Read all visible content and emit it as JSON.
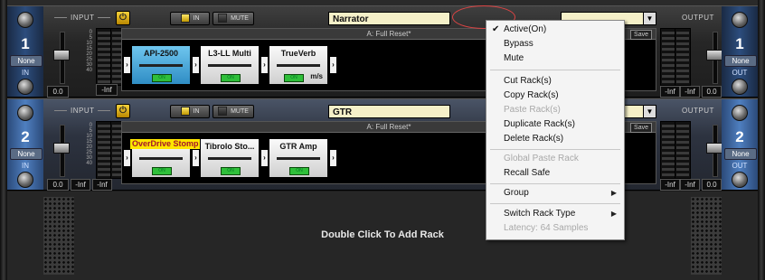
{
  "labels": {
    "input": "INPUT",
    "output": "OUTPUT",
    "in": "IN",
    "mute": "MUTE",
    "none": "None",
    "in_side": "IN",
    "out_side": "OUT",
    "save": "Save",
    "on": "ON"
  },
  "scale": [
    "0",
    "5",
    "10",
    "15",
    "20",
    "25",
    "30",
    "40"
  ],
  "rack1": {
    "number": "1",
    "name": "Narrator",
    "preset": "A: Full Reset*",
    "in_readouts": [
      "0.0",
      "-Inf"
    ],
    "out_readouts": [
      "-Inf",
      "-Inf",
      "0.0"
    ],
    "plugins": [
      {
        "name": "API-2500",
        "selected": true,
        "unit": ""
      },
      {
        "name": "L3-LL Multi",
        "selected": false,
        "unit": ""
      },
      {
        "name": "TrueVerb",
        "selected": false,
        "unit": "m/s"
      }
    ]
  },
  "rack2": {
    "number": "2",
    "name": "GTR",
    "preset": "A: Full Reset*",
    "in_readouts": [
      "0.0",
      "-Inf",
      "-Inf"
    ],
    "out_readouts": [
      "-Inf",
      "-Inf",
      "0.0"
    ],
    "plugins": [
      {
        "name": "OverDrive Stomp",
        "highlighted": true
      },
      {
        "name": "Tibrolo Sto..."
      },
      {
        "name": "GTR Amp"
      }
    ]
  },
  "empty_area": {
    "text": "Double Click To Add Rack"
  },
  "context_menu": {
    "items": [
      {
        "label": "Active(On)",
        "checked": true,
        "enabled": true
      },
      {
        "label": "Bypass",
        "enabled": true
      },
      {
        "label": "Mute",
        "enabled": true
      },
      {
        "label": "Cut Rack(s)",
        "enabled": true
      },
      {
        "label": "Copy Rack(s)",
        "enabled": true
      },
      {
        "label": "Paste Rack(s)",
        "enabled": false
      },
      {
        "label": "Duplicate Rack(s)",
        "enabled": true
      },
      {
        "label": "Delete Rack(s)",
        "enabled": true
      },
      {
        "label": "Global Paste Rack",
        "enabled": false
      },
      {
        "label": "Recall Safe",
        "enabled": true
      },
      {
        "label": "Group",
        "enabled": true,
        "submenu": true
      },
      {
        "label": "Switch Rack Type",
        "enabled": true,
        "submenu": true
      },
      {
        "label": "Latency: 64 Samples",
        "enabled": false
      }
    ]
  },
  "colors": {
    "accent": "#f7d33b",
    "selected_plugin": "#2f8dc4",
    "highlight": "#ffe600"
  }
}
